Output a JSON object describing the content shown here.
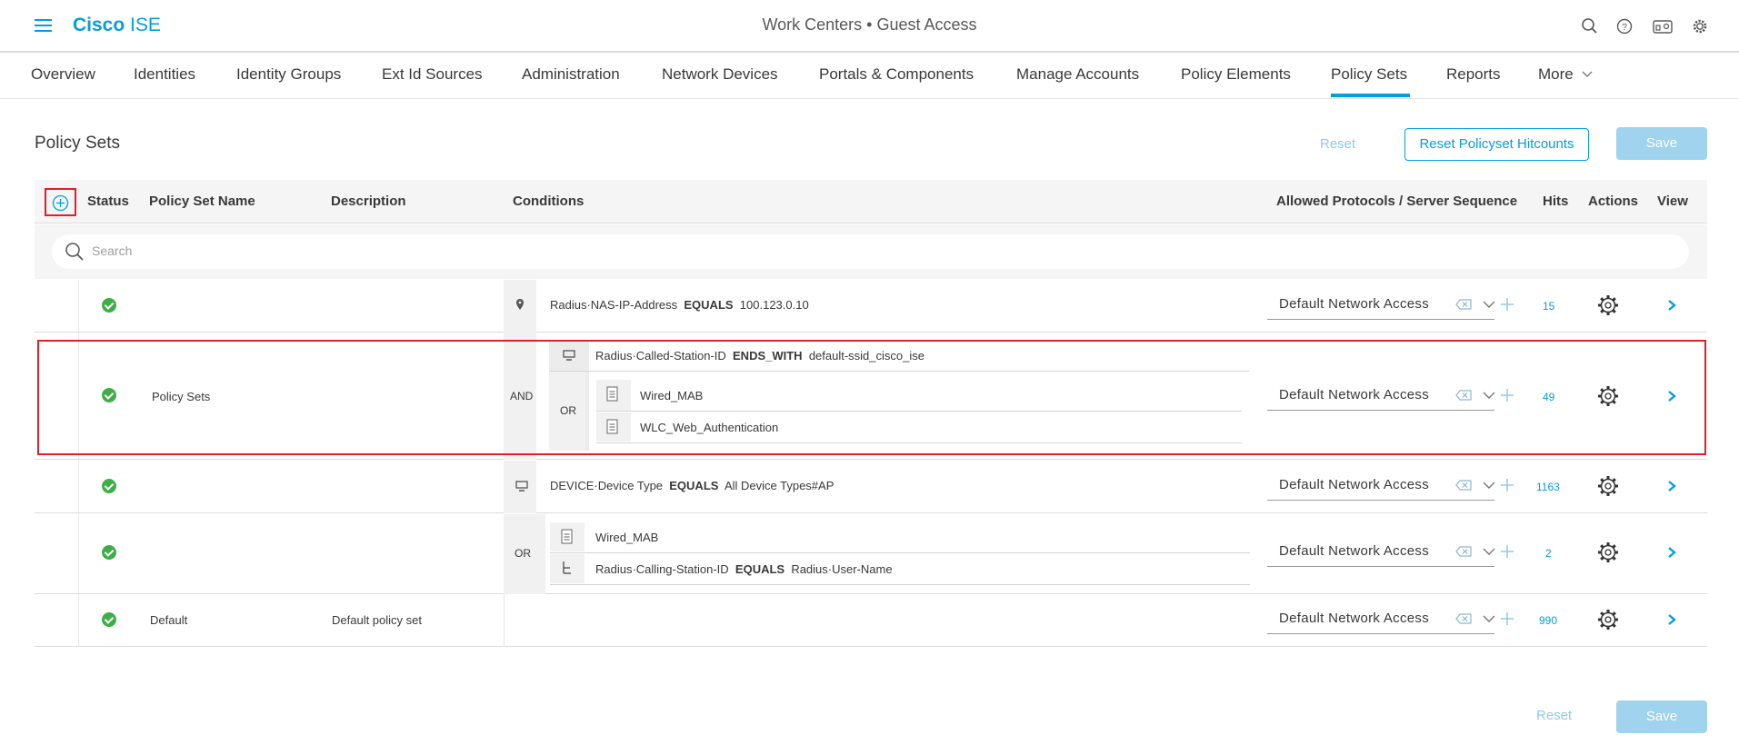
{
  "header": {
    "logo_bold": "Cisco",
    "logo_rest": " ISE",
    "page_title": "Work Centers • Guest Access",
    "icons": [
      "search-icon",
      "help-icon",
      "dashboard-icon",
      "gear-icon"
    ]
  },
  "nav": {
    "tabs": [
      "Overview",
      "Identities",
      "Identity Groups",
      "Ext Id Sources",
      "Administration",
      "Network Devices",
      "Portals & Components",
      "Manage Accounts",
      "Policy Elements",
      "Policy Sets",
      "Reports",
      "More"
    ],
    "active": "Policy Sets"
  },
  "page": {
    "title": "Policy Sets",
    "reset": "Reset",
    "reset_hitcounts": "Reset Policyset Hitcounts",
    "save": "Save"
  },
  "table": {
    "headers": {
      "status": "Status",
      "name": "Policy Set Name",
      "description": "Description",
      "conditions": "Conditions",
      "protocols": "Allowed Protocols / Server Sequence",
      "hits": "Hits",
      "actions": "Actions",
      "view": "View"
    },
    "search_placeholder": "Search",
    "rows": [
      {
        "name": "",
        "description": "",
        "cond1": {
          "attr": "Radius·NAS-IP-Address",
          "op": "EQUALS",
          "val": "100.123.0.10"
        },
        "protocol": "Default Network Access",
        "hits": "15"
      },
      {
        "name": "Policy Sets",
        "description": "",
        "and": "AND",
        "or": "OR",
        "cond1": {
          "attr": "Radius·Called-Station-ID",
          "op": "ENDS_WITH",
          "val": "default-ssid_cisco_ise"
        },
        "cond2": "Wired_MAB",
        "cond3": "WLC_Web_Authentication",
        "protocol": "Default Network Access",
        "hits": "49"
      },
      {
        "name": "",
        "description": "",
        "cond1": {
          "attr": "DEVICE·Device Type",
          "op": "EQUALS",
          "val": "All Device Types#AP"
        },
        "protocol": "Default Network Access",
        "hits": "1163"
      },
      {
        "name": "",
        "description": "",
        "or": "OR",
        "cond1": "Wired_MAB",
        "cond2": {
          "attr": "Radius·Calling-Station-ID",
          "op": "EQUALS",
          "val": "Radius·User-Name"
        },
        "protocol": "Default Network Access",
        "hits": "2"
      },
      {
        "name": "Default",
        "description": "Default policy set",
        "protocol": "Default Network Access",
        "hits": "990"
      }
    ]
  },
  "footer": {
    "reset": "Reset",
    "save": "Save"
  },
  "colors": {
    "accent": "#049fd9",
    "status_ok": "#3fae49",
    "highlight": "#e01f2d"
  }
}
